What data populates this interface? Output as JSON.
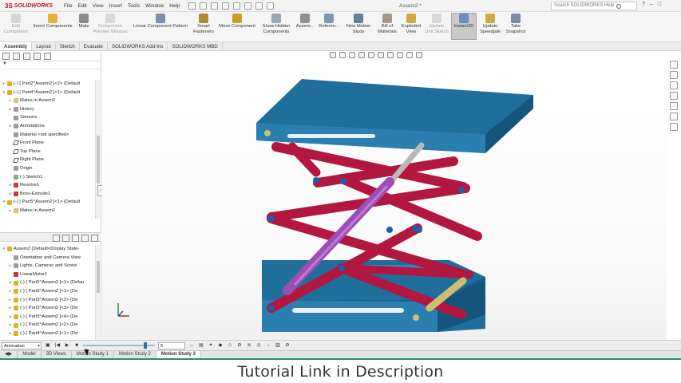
{
  "app": {
    "logo": "SOLIDWORKS",
    "window_title": "Assem2 *",
    "search_placeholder": "Search SOLIDWORKS Help"
  },
  "menu": [
    "File",
    "Edit",
    "View",
    "Insert",
    "Tools",
    "Window",
    "Help"
  ],
  "commands": [
    {
      "label": "Edit\nComponent",
      "disabled": true
    },
    {
      "label": "Insert Components",
      "disabled": false
    },
    {
      "label": "Mate",
      "disabled": false
    },
    {
      "label": "Component\nPreview Window",
      "disabled": true
    },
    {
      "label": "Linear Component Pattern",
      "disabled": false
    },
    {
      "label": "Smart\nFasteners",
      "disabled": false
    },
    {
      "label": "Move Component",
      "disabled": false
    },
    {
      "label": "Show Hidden\nComponents",
      "disabled": false
    },
    {
      "label": "Assem...",
      "disabled": false
    },
    {
      "label": "Referen...",
      "disabled": false
    },
    {
      "label": "New Motion\nStudy",
      "disabled": false
    },
    {
      "label": "Bill of\nMaterials",
      "disabled": false
    },
    {
      "label": "Exploded\nView",
      "disabled": false
    },
    {
      "label": "Update\nUnit Sketch",
      "disabled": true
    },
    {
      "label": "Instant3D",
      "disabled": false,
      "active": true
    },
    {
      "label": "Update\nSpeedpak",
      "disabled": false
    },
    {
      "label": "Take\nSnapshot",
      "disabled": false
    }
  ],
  "tabs": [
    "Assembly",
    "Layout",
    "Sketch",
    "Evaluate",
    "SOLIDWORKS Add-Ins",
    "SOLIDWORKS MBD"
  ],
  "active_tab": "Assembly",
  "tree": [
    {
      "label": "(-) [ Part2^Assem2 ]<2> (Default",
      "icon": "part",
      "exp": ">"
    },
    {
      "label": "(-) [ Part4^Assem2 ]<1> (Default",
      "icon": "part",
      "exp": "v"
    },
    {
      "label": "Mates in Assem2",
      "icon": "folder",
      "exp": ">",
      "indent": 1
    },
    {
      "label": "History",
      "icon": "grey",
      "exp": ">",
      "indent": 1
    },
    {
      "label": "Sensors",
      "icon": "grey",
      "exp": "",
      "indent": 1
    },
    {
      "label": "Annotations",
      "icon": "grey",
      "exp": ">",
      "indent": 1
    },
    {
      "label": "Material <not specified>",
      "icon": "grey",
      "exp": "",
      "indent": 1
    },
    {
      "label": "Front Plane",
      "icon": "plane",
      "exp": "",
      "indent": 1
    },
    {
      "label": "Top Plane",
      "icon": "plane",
      "exp": "",
      "indent": 1
    },
    {
      "label": "Right Plane",
      "icon": "plane",
      "exp": "",
      "indent": 1
    },
    {
      "label": "Origin",
      "icon": "grey",
      "exp": "",
      "indent": 1
    },
    {
      "label": "(-) Sketch1",
      "icon": "grey",
      "exp": "",
      "indent": 1
    },
    {
      "label": "Revolve1",
      "icon": "red",
      "exp": ">",
      "indent": 1
    },
    {
      "label": "Boss-Extrude1",
      "icon": "red",
      "exp": ">",
      "indent": 1
    },
    {
      "label": "(-) [ Part5^Assem2 ]<1> (Default",
      "icon": "part",
      "exp": "v"
    },
    {
      "label": "Mates in Assem2",
      "icon": "folder",
      "exp": ">",
      "indent": 1
    }
  ],
  "tree2": [
    {
      "label": "Assem2 (Default<Display State-",
      "icon": "part",
      "exp": "v"
    },
    {
      "label": "Orientation and Camera View",
      "icon": "grey",
      "exp": "",
      "indent": 1
    },
    {
      "label": "Lights, Cameras and Scene",
      "icon": "grey",
      "exp": ">",
      "indent": 1
    },
    {
      "label": "LinearMotor1",
      "icon": "red",
      "exp": "",
      "indent": 1
    },
    {
      "label": "(-) [ Part2^Assem2 ]<1> (Defau",
      "icon": "part",
      "exp": ">",
      "indent": 1
    },
    {
      "label": "(-) [ Part3^Assem2 ]<1> (De",
      "icon": "part",
      "exp": ">",
      "indent": 1
    },
    {
      "label": "(-) [ Part3^Assem2 ]<2> (De",
      "icon": "part",
      "exp": ">",
      "indent": 1
    },
    {
      "label": "(-) [ Part3^Assem2 ]<3> (De",
      "icon": "part",
      "exp": ">",
      "indent": 1
    },
    {
      "label": "(-) [ Part3^Assem2 ]<4> (De",
      "icon": "part",
      "exp": ">",
      "indent": 1
    },
    {
      "label": "(-) [ Part2^Assem2 ]<2> (De",
      "icon": "part",
      "exp": ">",
      "indent": 1
    },
    {
      "label": "(-) [ Part4^Assem2 ]<1> (De",
      "icon": "part",
      "exp": ">",
      "indent": 1
    }
  ],
  "motion": {
    "study_type": "Animation",
    "playback_speed_label": "5",
    "timeline_position": 0.88
  },
  "bottom_tabs": [
    "Model",
    "3D Views",
    "Motion Study 1",
    "Motion Study 2",
    "Motion Study 3"
  ],
  "active_bottom_tab": "Motion Study 3",
  "caption": "Tutorial Link in Description",
  "colors": {
    "plate": "#1f6e9c",
    "link": "#b2173f",
    "cylinder": "#9b4fb5",
    "rod": "#b8b8b8",
    "pin": "#1f5fa8",
    "roller": "#cdbf6e"
  }
}
